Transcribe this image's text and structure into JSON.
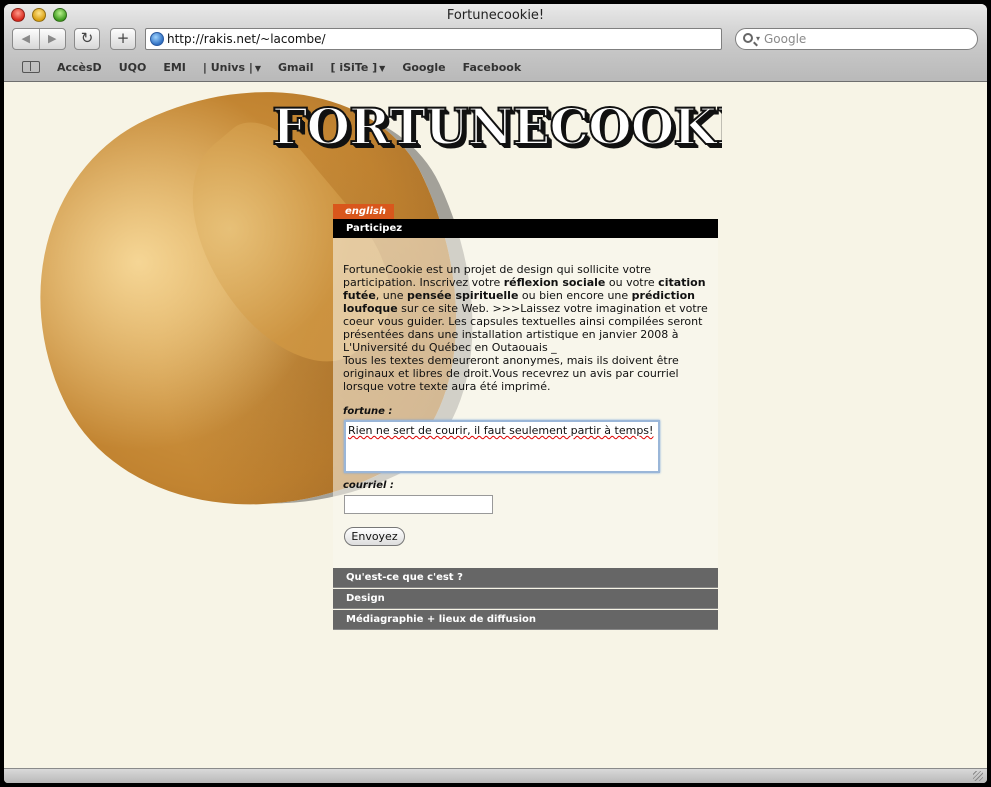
{
  "window": {
    "title": "Fortunecookie!"
  },
  "toolbar": {
    "back_glyph": "◀",
    "forward_glyph": "▶",
    "reload_glyph": "↻",
    "add_glyph": "+",
    "url": "http://rakis.net/~lacombe/",
    "search_placeholder": "Google"
  },
  "bookmarks": [
    "AccèsD",
    "UQO",
    "EMI",
    "| Univs |",
    "Gmail",
    "[ iSiTe ]",
    "Google",
    "Facebook"
  ],
  "page": {
    "logo": "FORTUNECOOKIE",
    "lang_tab": "english",
    "section_title": "Participez",
    "intro_parts": [
      "FortuneCookie est un projet de design qui sollicite votre participation. Inscrivez votre ",
      "réflexion sociale",
      " ou votre ",
      "citation futée",
      ", une ",
      "pensée spirituelle",
      " ou bien encore une ",
      "prédiction loufoque",
      " sur ce site Web. >>>Laissez votre imagination et votre coeur vous guider. Les capsules textuelles ainsi compilées seront présentées dans une installation artistique en janvier 2008 à L'Université du Québec en Outaouais _",
      "Tous les textes demeureront anonymes, mais ils doivent être originaux et libres de droit.Vous recevrez un avis par courriel lorsque votre texte aura été imprimé."
    ],
    "fortune_label": "fortune :",
    "fortune_value": "Rien ne sert de courir, il faut seulement partir à temps!",
    "email_label": "courriel :",
    "email_value": "",
    "submit_label": "Envoyez",
    "menu": [
      "Qu'est-ce que c'est ?",
      "Design",
      "Médiagraphie + lieux de diffusion"
    ]
  },
  "colors": {
    "page_bg": "#f7f4e6",
    "lang_tab": "#d9571c",
    "section_bar": "#000000",
    "menu_bar": "#666666"
  }
}
